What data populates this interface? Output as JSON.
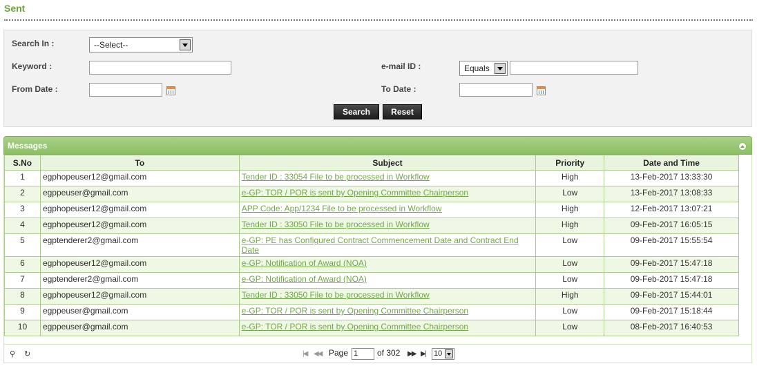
{
  "page": {
    "title": "Sent"
  },
  "search": {
    "search_in_label": "Search In :",
    "search_in_value": "--Select--",
    "keyword_label": "Keyword :",
    "keyword_value": "",
    "email_label": "e-mail ID :",
    "email_operator": "Equals",
    "email_value": "",
    "from_date_label": "From Date :",
    "from_date_value": "",
    "to_date_label": "To Date :",
    "to_date_value": "",
    "search_button": "Search",
    "reset_button": "Reset"
  },
  "messages": {
    "title": "Messages",
    "columns": [
      "S.No",
      "To",
      "Subject",
      "Priority",
      "Date and Time"
    ],
    "rows": [
      {
        "sno": "1",
        "to": "egphopeuser12@gmail.com",
        "subject": "Tender ID : 33054 File to be processed in Workflow",
        "priority": "High",
        "datetime": "13-Feb-2017 13:33:30"
      },
      {
        "sno": "2",
        "to": "egppeuser@gmail.com",
        "subject": "e-GP: TOR / POR is sent by Opening Committee Chairperson",
        "priority": "Low",
        "datetime": "13-Feb-2017 13:08:33"
      },
      {
        "sno": "3",
        "to": "egphopeuser12@gmail.com",
        "subject": "APP Code: App/1234 File to be processed in Workflow",
        "priority": "High",
        "datetime": "12-Feb-2017 13:07:21"
      },
      {
        "sno": "4",
        "to": "egphopeuser12@gmail.com",
        "subject": "Tender ID : 33050 File to be processed in Workflow",
        "priority": "High",
        "datetime": "09-Feb-2017 16:05:15"
      },
      {
        "sno": "5",
        "to": "egptenderer2@gmail.com",
        "subject": "e-GP: PE has Configured Contract Commencement Date and Contract End Date",
        "priority": "Low",
        "datetime": "09-Feb-2017 15:55:54"
      },
      {
        "sno": "6",
        "to": "egphopeuser12@gmail.com",
        "subject": "e-GP: Notification of Award (NOA)",
        "priority": "Low",
        "datetime": "09-Feb-2017 15:47:18"
      },
      {
        "sno": "7",
        "to": "egptenderer2@gmail.com",
        "subject": "e-GP: Notification of Award (NOA)",
        "priority": "Low",
        "datetime": "09-Feb-2017 15:47:18"
      },
      {
        "sno": "8",
        "to": "egphopeuser12@gmail.com",
        "subject": "Tender ID : 33050 File to be processed in Workflow",
        "priority": "High",
        "datetime": "09-Feb-2017 15:44:01"
      },
      {
        "sno": "9",
        "to": "egppeuser@gmail.com",
        "subject": "e-GP: TOR / POR is sent by Opening Committee Chairperson",
        "priority": "Low",
        "datetime": "09-Feb-2017 15:18:44"
      },
      {
        "sno": "10",
        "to": "egppeuser@gmail.com",
        "subject": "e-GP: TOR / POR is sent by Opening Committee Chairperson",
        "priority": "Low",
        "datetime": "08-Feb-2017 16:40:53"
      }
    ]
  },
  "pager": {
    "page_label": "Page",
    "page_value": "1",
    "of_label": "of 302",
    "page_size": "10",
    "icons": {
      "search": "search-icon",
      "refresh": "refresh-icon",
      "first": "first-page-icon",
      "prev": "prev-page-icon",
      "next": "next-page-icon",
      "last": "last-page-icon"
    }
  },
  "colors": {
    "title": "#6aa63c",
    "header_green": "#8cbf63",
    "row_alt": "#eef8e4",
    "link": "#72a848"
  }
}
